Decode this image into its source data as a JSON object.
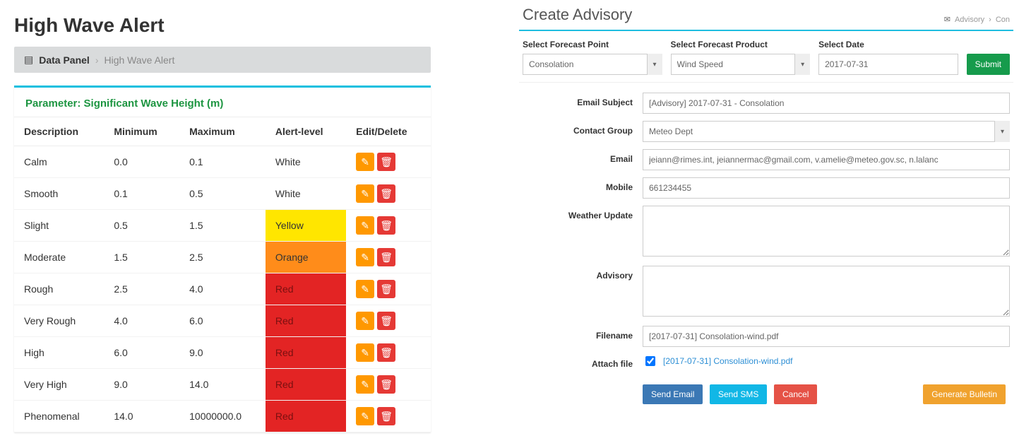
{
  "left": {
    "page_title": "High Wave Alert",
    "breadcrumb": {
      "root": "Data Panel",
      "current": "High Wave Alert"
    },
    "parameter_title": "Parameter: Significant Wave Height (m)",
    "columns": {
      "desc": "Description",
      "min": "Minimum",
      "max": "Maximum",
      "alert": "Alert-level",
      "actions": "Edit/Delete"
    },
    "rows": [
      {
        "desc": "Calm",
        "min": "0.0",
        "max": "0.1",
        "alert": "White"
      },
      {
        "desc": "Smooth",
        "min": "0.1",
        "max": "0.5",
        "alert": "White"
      },
      {
        "desc": "Slight",
        "min": "0.5",
        "max": "1.5",
        "alert": "Yellow"
      },
      {
        "desc": "Moderate",
        "min": "1.5",
        "max": "2.5",
        "alert": "Orange"
      },
      {
        "desc": "Rough",
        "min": "2.5",
        "max": "4.0",
        "alert": "Red"
      },
      {
        "desc": "Very Rough",
        "min": "4.0",
        "max": "6.0",
        "alert": "Red"
      },
      {
        "desc": "High",
        "min": "6.0",
        "max": "9.0",
        "alert": "Red"
      },
      {
        "desc": "Very High",
        "min": "9.0",
        "max": "14.0",
        "alert": "Red"
      },
      {
        "desc": "Phenomenal",
        "min": "14.0",
        "max": "10000000.0",
        "alert": "Red"
      }
    ]
  },
  "right": {
    "title": "Create Advisory",
    "crumbs": {
      "a": "Advisory",
      "b": "Con"
    },
    "filters": {
      "forecast_point": {
        "label": "Select Forecast Point",
        "value": "Consolation"
      },
      "forecast_product": {
        "label": "Select Forecast Product",
        "value": "Wind Speed"
      },
      "date": {
        "label": "Select Date",
        "value": "2017-07-31"
      },
      "submit": "Submit"
    },
    "form": {
      "email_subject": {
        "label": "Email Subject",
        "value": "[Advisory] 2017-07-31 - Consolation"
      },
      "contact_group": {
        "label": "Contact Group",
        "value": "Meteo Dept"
      },
      "email": {
        "label": "Email",
        "value": "jeiann@rimes.int, jeiannermac@gmail.com, v.amelie@meteo.gov.sc, n.lalanc"
      },
      "mobile": {
        "label": "Mobile",
        "value": "661234455"
      },
      "weather_update": {
        "label": "Weather Update",
        "value": ""
      },
      "advisory": {
        "label": "Advisory",
        "value": ""
      },
      "filename": {
        "label": "Filename",
        "value": "[2017-07-31] Consolation-wind.pdf"
      },
      "attach": {
        "label": "Attach file",
        "link": "[2017-07-31] Consolation-wind.pdf"
      }
    },
    "buttons": {
      "send_email": "Send Email",
      "send_sms": "Send SMS",
      "cancel": "Cancel",
      "generate": "Generate Bulletin"
    }
  }
}
